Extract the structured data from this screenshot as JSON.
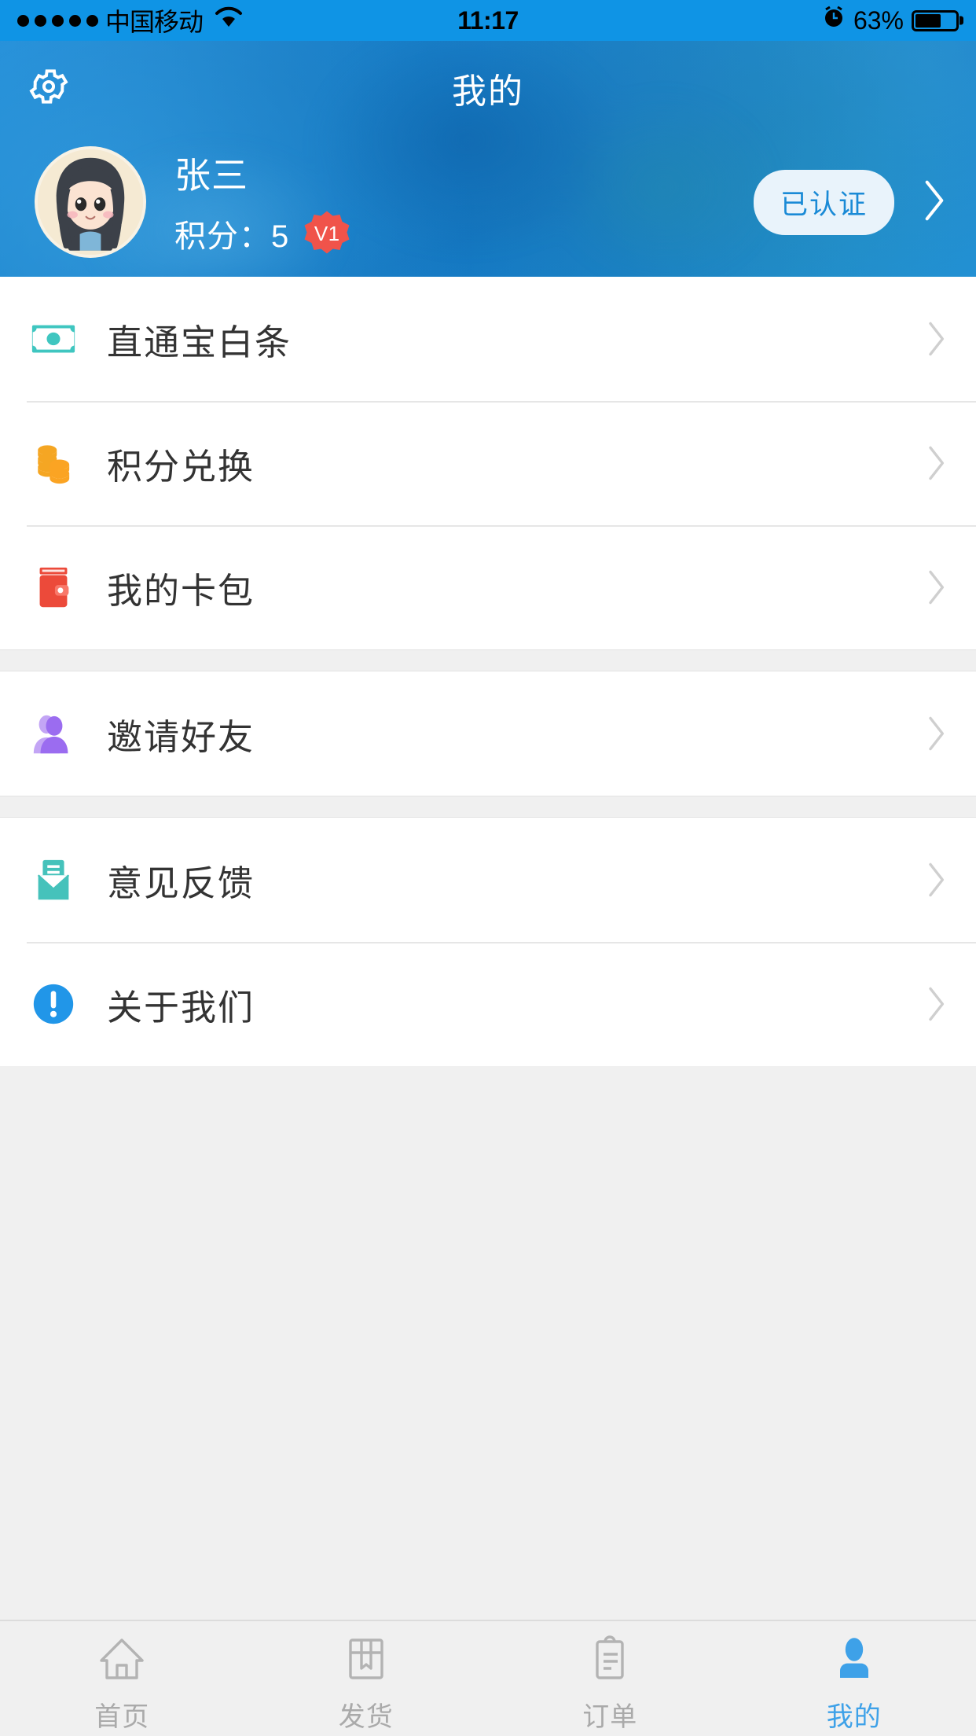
{
  "statusbar": {
    "signal_dots": 5,
    "carrier": "中国移动",
    "wifi_icon": "wifi-icon",
    "time": "11:17",
    "alarm_icon": "alarm-icon",
    "battery_percent": "63%",
    "battery_level": 63
  },
  "header": {
    "settings_icon": "gear-icon",
    "title": "我的"
  },
  "profile": {
    "avatar_icon": "avatar",
    "name": "张三",
    "points_label": "积分：5",
    "level_badge": "V1",
    "verify_label": "已认证",
    "chevron_icon": "chevron-right-icon"
  },
  "menu_groups": [
    {
      "items": [
        {
          "label": "直通宝白条",
          "icon": "banknote-icon",
          "color": "#3fc6c0"
        },
        {
          "label": "积分兑换",
          "icon": "coins-icon",
          "color": "#f5a623"
        },
        {
          "label": "我的卡包",
          "icon": "wallet-icon",
          "color": "#ec4a3a"
        }
      ]
    },
    {
      "items": [
        {
          "label": "邀请好友",
          "icon": "invite-friend-icon",
          "color": "#9b6cf0"
        }
      ]
    },
    {
      "items": [
        {
          "label": "意见反馈",
          "icon": "feedback-envelope-icon",
          "color": "#45c2bb"
        },
        {
          "label": "关于我们",
          "icon": "info-circle-icon",
          "color": "#2196e8"
        }
      ]
    }
  ],
  "tabs": [
    {
      "label": "首页",
      "icon": "home-icon",
      "active": false
    },
    {
      "label": "发货",
      "icon": "shipping-box-icon",
      "active": false
    },
    {
      "label": "订单",
      "icon": "clipboard-order-icon",
      "active": false
    },
    {
      "label": "我的",
      "icon": "user-profile-icon",
      "active": true
    }
  ],
  "colors": {
    "status_bar": "#0f94e5",
    "accent": "#3ea1e8",
    "tab_inactive": "#aaaaaa",
    "list_bg": "#f0f0f0",
    "row_text": "#333333"
  }
}
